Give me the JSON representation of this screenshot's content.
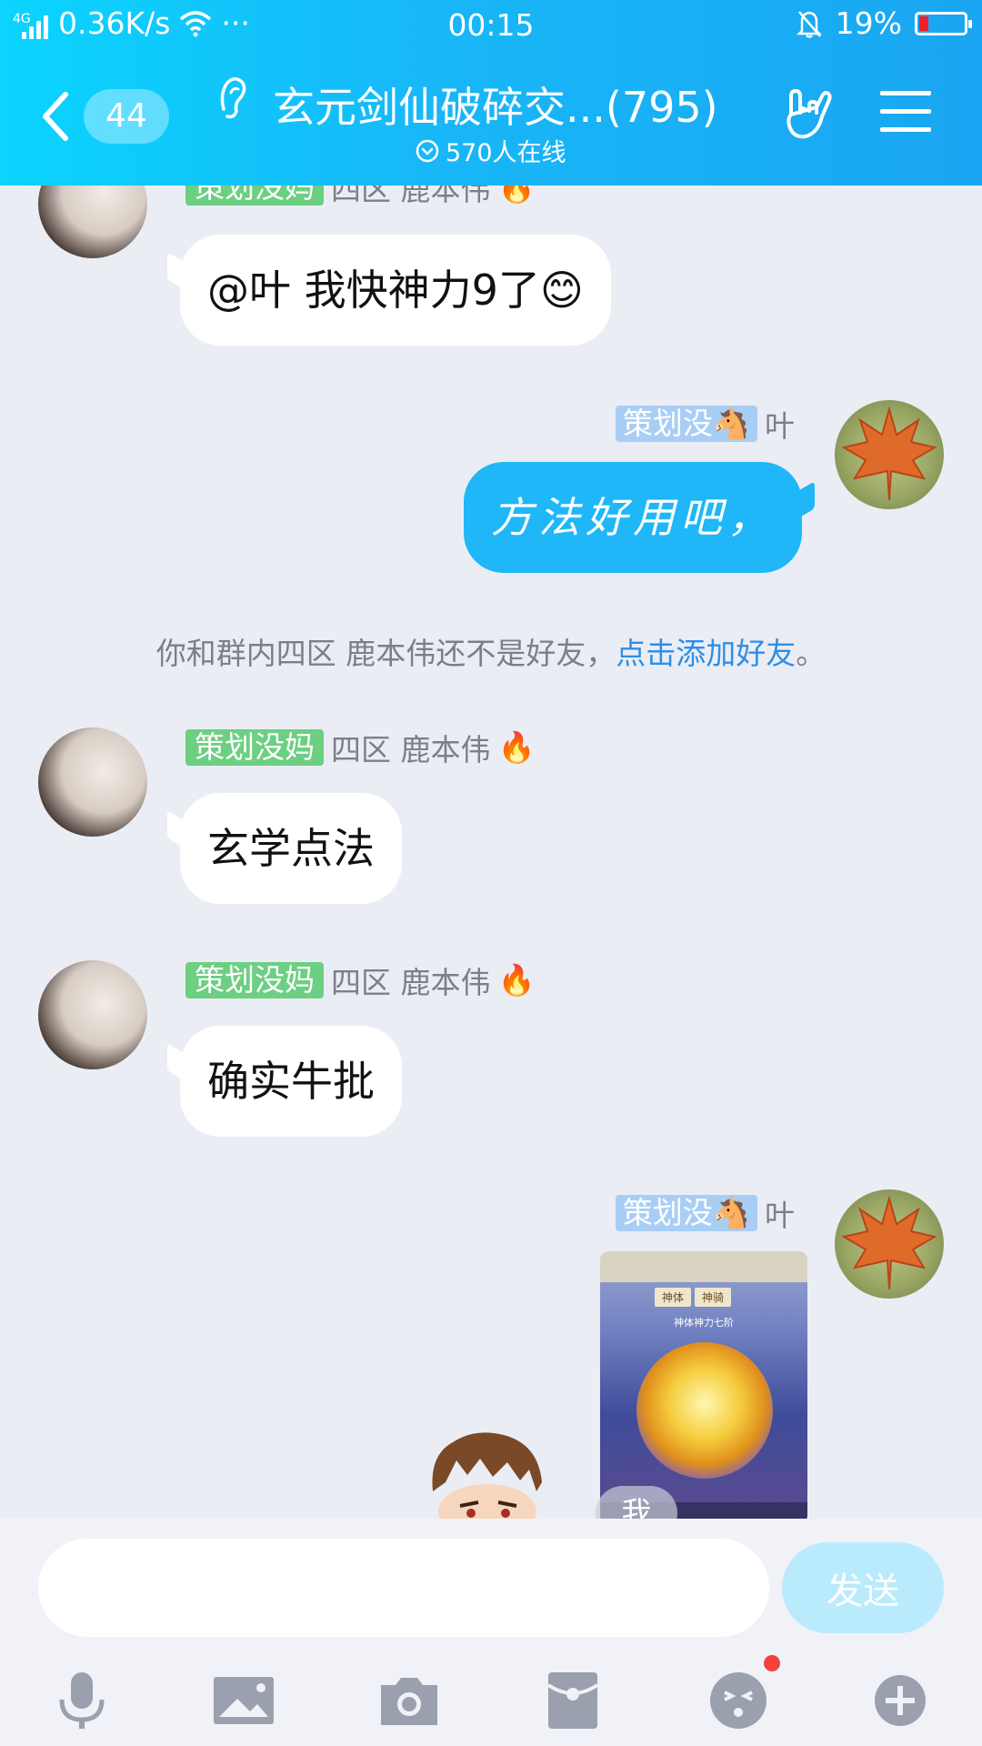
{
  "status_bar": {
    "network_type": "4G",
    "speed": "0.36K/s",
    "more": "···",
    "time": "00:15",
    "battery_percent": "19%",
    "battery_level": 0.19
  },
  "header": {
    "unread_count": "44",
    "title": "玄元剑仙破碎交...(795)",
    "online": "570人在线",
    "accent_color": "#1aa6f2"
  },
  "messages": [
    {
      "sender_tag": "策划没妈",
      "sender_name": "四区 鹿本伟",
      "text": "@叶 我快神力9了😊"
    },
    {
      "sender_tag": "策划没🐴",
      "sender_name": "叶",
      "text": "方法好用吧，"
    },
    {
      "notice_text": "你和群内四区 鹿本伟还不是好友，",
      "notice_link": "点击添加好友",
      "notice_end": "。"
    },
    {
      "sender_tag": "策划没妈",
      "sender_name": "四区 鹿本伟",
      "text": "玄学点法"
    },
    {
      "sender_tag": "策划没妈",
      "sender_name": "四区 鹿本伟",
      "text": "确实牛批"
    },
    {
      "sender_tag": "策划没🐴",
      "sender_name": "叶",
      "image_title": "神体神力七阶",
      "image_tabs": [
        "神体",
        "神骑"
      ],
      "self_badge": "我"
    }
  ],
  "input": {
    "placeholder": "",
    "send_label": "发送"
  },
  "toolbar": [
    "mic-icon",
    "image-icon",
    "camera-icon",
    "red-packet-icon",
    "emoji-icon",
    "plus-icon"
  ]
}
